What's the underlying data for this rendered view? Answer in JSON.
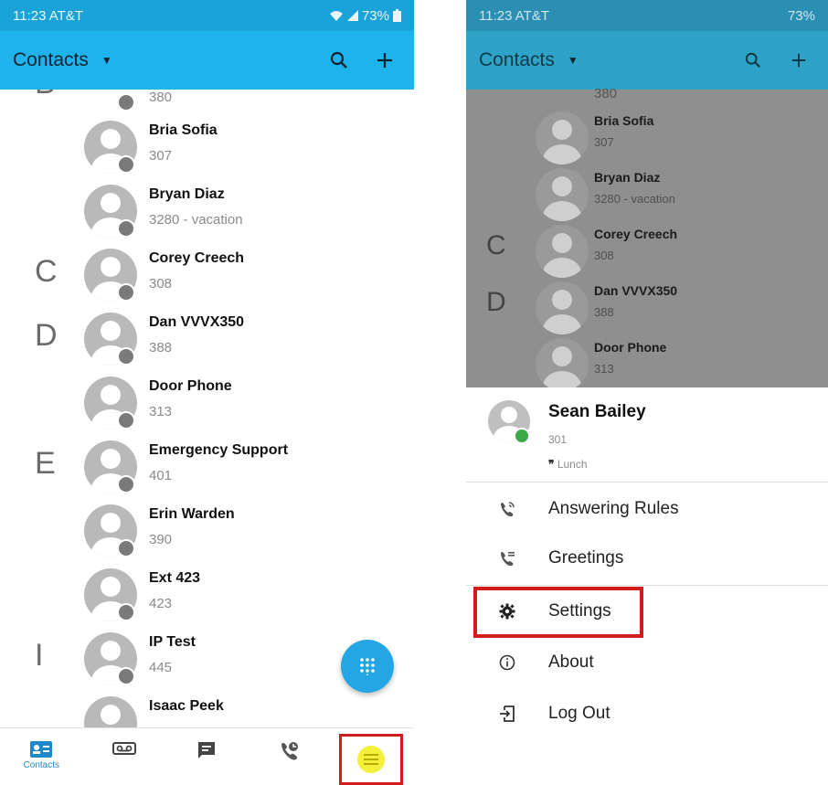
{
  "left_phone": {
    "status": {
      "time_carrier": "11:23 AT&T",
      "battery": "73%"
    },
    "appbar": {
      "title": "Contacts"
    },
    "top_partial": {
      "letter": "B",
      "ext": "380"
    },
    "contacts": [
      {
        "letter": "",
        "name": "Bria Sofia",
        "ext": "307"
      },
      {
        "letter": "",
        "name": "Bryan Diaz",
        "ext": "3280 - vacation"
      },
      {
        "letter": "C",
        "name": "Corey Creech",
        "ext": "308"
      },
      {
        "letter": "D",
        "name": "Dan VVVX350",
        "ext": "388"
      },
      {
        "letter": "",
        "name": "Door Phone",
        "ext": "313"
      },
      {
        "letter": "E",
        "name": "Emergency Support",
        "ext": "401"
      },
      {
        "letter": "",
        "name": "Erin Warden",
        "ext": "390"
      },
      {
        "letter": "",
        "name": "Ext 423",
        "ext": "423"
      },
      {
        "letter": "I",
        "name": "IP Test",
        "ext": "445"
      },
      {
        "letter": "",
        "name": "Isaac Peek",
        "ext": ""
      }
    ],
    "bottom_nav": {
      "contacts_label": "Contacts"
    },
    "icons": [
      "search-icon",
      "add-icon",
      "dialpad-icon",
      "contacts-icon",
      "voicemail-icon",
      "chat-icon",
      "call-history-icon",
      "menu-icon"
    ]
  },
  "right_phone": {
    "status": {
      "time_carrier": "11:23 AT&T",
      "battery": "73%"
    },
    "appbar": {
      "title": "Contacts"
    },
    "top_partial": {
      "ext": "380"
    },
    "contacts": [
      {
        "letter": "",
        "name": "Bria Sofia",
        "ext": "307"
      },
      {
        "letter": "",
        "name": "Bryan Diaz",
        "ext": "3280 - vacation"
      },
      {
        "letter": "C",
        "name": "Corey Creech",
        "ext": "308"
      },
      {
        "letter": "D",
        "name": "Dan VVVX350",
        "ext": "388"
      },
      {
        "letter": "",
        "name": "Door Phone",
        "ext": "313"
      }
    ],
    "profile": {
      "name": "Sean Bailey",
      "ext": "301",
      "status": "Lunch"
    },
    "menu": [
      {
        "icon": "answering-rules-icon",
        "label": "Answering Rules"
      },
      {
        "icon": "greetings-icon",
        "label": "Greetings"
      },
      {
        "icon": "settings-icon",
        "label": "Settings"
      },
      {
        "icon": "about-icon",
        "label": "About"
      },
      {
        "icon": "logout-icon",
        "label": "Log Out"
      }
    ]
  },
  "colors": {
    "appbar": "#1eb3ec",
    "statusbar": "#19a3d9",
    "highlight": "#d01c1c",
    "fab": "#23a6e3",
    "menu_yellow": "#f4f03a",
    "presence_green": "#39a94a"
  }
}
